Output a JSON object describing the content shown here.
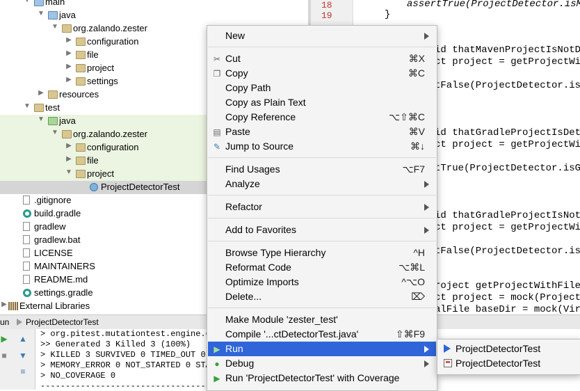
{
  "tree": {
    "rows": [
      {
        "label": "main",
        "kind": "src",
        "arrow": "▼",
        "indent": 0
      },
      {
        "label": "java",
        "kind": "src",
        "arrow": "▼",
        "indent": 1
      },
      {
        "label": "org.zalando.zester",
        "kind": "pkg",
        "arrow": "▼",
        "indent": 2
      },
      {
        "label": "configuration",
        "kind": "pkg",
        "arrow": "▶",
        "indent": 3
      },
      {
        "label": "file",
        "kind": "pkg",
        "arrow": "▶",
        "indent": 3
      },
      {
        "label": "project",
        "kind": "pkg",
        "arrow": "▶",
        "indent": 3
      },
      {
        "label": "settings",
        "kind": "pkg",
        "arrow": "▶",
        "indent": 3
      },
      {
        "label": "resources",
        "kind": "pkg",
        "arrow": "▶",
        "indent": 1
      },
      {
        "label": "test",
        "kind": "pkg",
        "arrow": "▼",
        "indent": 0
      },
      {
        "label": "java",
        "kind": "test",
        "arrow": "▼",
        "indent": 1
      },
      {
        "label": "org.zalando.zester",
        "kind": "pkg",
        "arrow": "▼",
        "indent": 2
      },
      {
        "label": "configuration",
        "kind": "pkg",
        "arrow": "▶",
        "indent": 3
      },
      {
        "label": "file",
        "kind": "pkg",
        "arrow": "▶",
        "indent": 3
      },
      {
        "label": "project",
        "kind": "pkg",
        "arrow": "▼",
        "indent": 3
      },
      {
        "label": "ProjectDetectorTest",
        "kind": "class",
        "arrow": "",
        "indent": 4
      },
      {
        "label": ".gitignore",
        "kind": "file",
        "arrow": "",
        "indent": 0
      },
      {
        "label": "build.gradle",
        "kind": "gradle",
        "arrow": "",
        "indent": 0
      },
      {
        "label": "gradlew",
        "kind": "file",
        "arrow": "",
        "indent": 0
      },
      {
        "label": "gradlew.bat",
        "kind": "file",
        "arrow": "",
        "indent": 0
      },
      {
        "label": "LICENSE",
        "kind": "file",
        "arrow": "",
        "indent": 0
      },
      {
        "label": "MAINTAINERS",
        "kind": "file",
        "arrow": "",
        "indent": 0
      },
      {
        "label": "README.md",
        "kind": "file",
        "arrow": "",
        "indent": 0
      },
      {
        "label": "settings.gradle",
        "kind": "gradle",
        "arrow": "",
        "indent": 0
      },
      {
        "label": "External Libraries",
        "kind": "libs",
        "arrow": "▶",
        "indent": -1
      }
    ]
  },
  "editor": {
    "line_numbers": [
      "18",
      "19"
    ],
    "lines": [
      {
        "text": "assertTrue(ProjectDetector.isMa"
      },
      {
        "text": "}"
      },
      {
        "text": "id thatMavenProjectIsNotDe"
      },
      {
        "text": "ct project = getProjectWit"
      },
      {
        "text": "tFalse(ProjectDetector.isM"
      },
      {
        "text": "id thatGradleProjectIsDete"
      },
      {
        "text": "ct project = getProjectWit"
      },
      {
        "text": "tTrue(ProjectDetector.isGr"
      },
      {
        "text": "id thatGradleProjectIsNotD"
      },
      {
        "text": "ct project = getProjectWit"
      },
      {
        "text": "tFalse(ProjectDetector.isG"
      },
      {
        "text": "roject getProjectWithFileI"
      },
      {
        "text": "ct project = mock(Project."
      },
      {
        "text": "alFile baseDir = mock(Virt"
      }
    ]
  },
  "run_panel": {
    "title_prefix": "un",
    "tab": "ProjectDetectorTest",
    "console": [
      "> org.pitest.mutationtest.engine.g",
      ">> Generated 3 Killed 3 (100%)",
      "> KILLED 3 SURVIVED 0 TIMED_OUT 0",
      "> MEMORY_ERROR 0 NOT_STARTED 0 STA",
      "> NO_COVERAGE 0",
      "--------------------------------------------"
    ]
  },
  "context_menu": {
    "items": [
      {
        "label": "New",
        "shortcut": "",
        "submenu": true,
        "icon": ""
      },
      {
        "sep": true
      },
      {
        "label": "Cut",
        "shortcut": "⌘X",
        "submenu": false,
        "icon": "scissors-icon"
      },
      {
        "label": "Copy",
        "shortcut": "⌘C",
        "submenu": false,
        "icon": "copy-icon"
      },
      {
        "label": "Copy Path",
        "shortcut": "",
        "submenu": false,
        "icon": ""
      },
      {
        "label": "Copy as Plain Text",
        "shortcut": "",
        "submenu": false,
        "icon": ""
      },
      {
        "label": "Copy Reference",
        "shortcut": "⌥⇧⌘C",
        "submenu": false,
        "icon": ""
      },
      {
        "label": "Paste",
        "shortcut": "⌘V",
        "submenu": false,
        "icon": "paste-icon"
      },
      {
        "label": "Jump to Source",
        "shortcut": "⌘↓",
        "submenu": false,
        "icon": "jump-icon"
      },
      {
        "sep": true
      },
      {
        "label": "Find Usages",
        "shortcut": "⌥F7",
        "submenu": false,
        "icon": ""
      },
      {
        "label": "Analyze",
        "shortcut": "",
        "submenu": true,
        "icon": ""
      },
      {
        "sep": true
      },
      {
        "label": "Refactor",
        "shortcut": "",
        "submenu": true,
        "icon": ""
      },
      {
        "sep": true
      },
      {
        "label": "Add to Favorites",
        "shortcut": "",
        "submenu": true,
        "icon": ""
      },
      {
        "sep": true
      },
      {
        "label": "Browse Type Hierarchy",
        "shortcut": "^H",
        "submenu": false,
        "icon": ""
      },
      {
        "label": "Reformat Code",
        "shortcut": "⌥⌘L",
        "submenu": false,
        "icon": ""
      },
      {
        "label": "Optimize Imports",
        "shortcut": "^⌥O",
        "submenu": false,
        "icon": ""
      },
      {
        "label": "Delete...",
        "shortcut": "⌦",
        "submenu": false,
        "icon": ""
      },
      {
        "sep": true
      },
      {
        "label": "Make Module 'zester_test'",
        "shortcut": "",
        "submenu": false,
        "icon": ""
      },
      {
        "label": "Compile '...ctDetectorTest.java'",
        "shortcut": "⇧⌘F9",
        "submenu": false,
        "icon": ""
      },
      {
        "label": "Run",
        "shortcut": "",
        "submenu": true,
        "icon": "run-icon",
        "active": true
      },
      {
        "label": "Debug",
        "shortcut": "",
        "submenu": true,
        "icon": "debug-icon"
      },
      {
        "label": "Run 'ProjectDetectorTest' with Coverage",
        "shortcut": "",
        "submenu": false,
        "icon": "coverage-icon"
      }
    ]
  },
  "run_submenu": {
    "items": [
      {
        "label": "ProjectDetectorTest",
        "icon": "run-icon"
      },
      {
        "label": "ProjectDetectorTest",
        "icon": "config-icon"
      }
    ]
  },
  "colors": {
    "accent": "#2f65d8",
    "test_bg": "#ebf5e1",
    "selected_bg": "#d5d5d5"
  }
}
